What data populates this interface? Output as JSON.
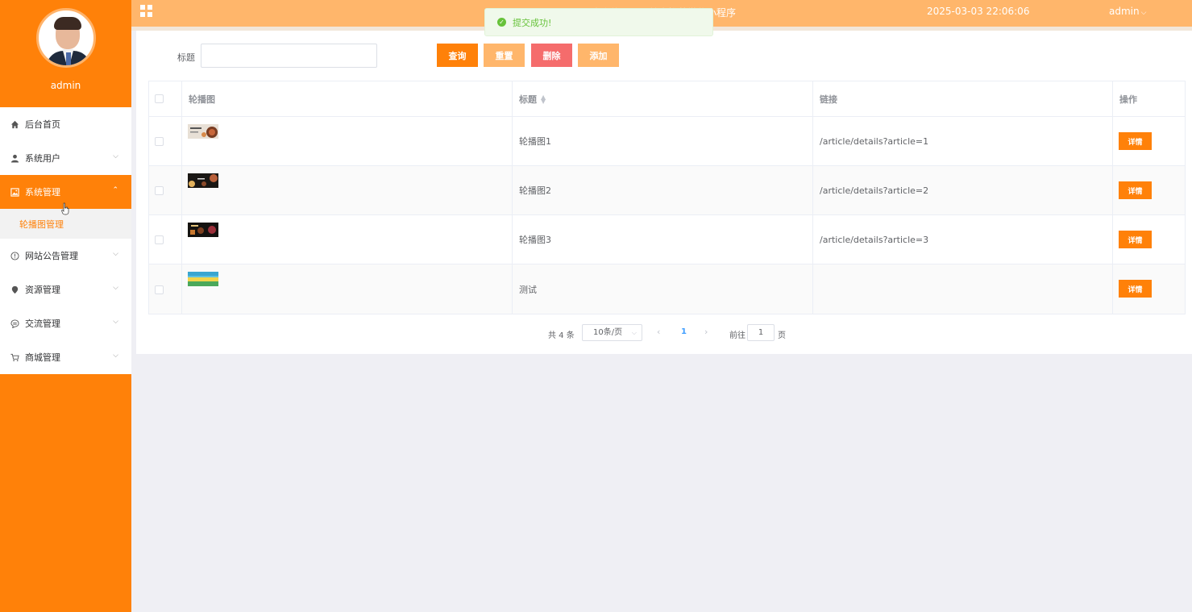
{
  "sidebar": {
    "username": "admin",
    "menu": [
      {
        "label": "后台首页",
        "icon": "home-icon",
        "has_children": false
      },
      {
        "label": "系统用户",
        "icon": "user-icon",
        "has_children": true
      },
      {
        "label": "系统管理",
        "icon": "picture-icon",
        "has_children": true,
        "active": true,
        "expanded": true
      },
      {
        "label": "网站公告管理",
        "icon": "info-circle-icon",
        "has_children": true
      },
      {
        "label": "资源管理",
        "icon": "location-pin-icon",
        "has_children": true
      },
      {
        "label": "交流管理",
        "icon": "chat-bubble-icon",
        "has_children": true
      },
      {
        "label": "商城管理",
        "icon": "shopping-cart-icon",
        "has_children": true
      }
    ],
    "submenu_active": "轮播图管理"
  },
  "header": {
    "title": "欢迎使用源面美食推荐微信小程序",
    "datetime": "2025-03-03 22:06:06",
    "user": "admin"
  },
  "toast": {
    "message": "提交成功!",
    "type": "success"
  },
  "search": {
    "label": "标题",
    "value": "",
    "buttons": {
      "query": "查询",
      "reset": "重置",
      "delete": "删除",
      "add": "添加"
    }
  },
  "table": {
    "columns": [
      "轮播图",
      "标题",
      "链接",
      "操作"
    ],
    "rows": [
      {
        "title": "轮播图1",
        "link": "/article/details?article=1",
        "action": "详情"
      },
      {
        "title": "轮播图2",
        "link": "/article/details?article=2",
        "action": "详情"
      },
      {
        "title": "轮播图3",
        "link": "/article/details?article=3",
        "action": "详情"
      },
      {
        "title": "测试",
        "link": "",
        "action": "详情"
      }
    ]
  },
  "pagination": {
    "total_text": "共 4 条",
    "page_size": "10条/页",
    "current_page": "1",
    "goto_label": "前往",
    "goto_value": "1",
    "goto_unit": "页"
  },
  "colors": {
    "primary": "#ff8109",
    "header": "#ffb66b",
    "danger": "#f56c6c",
    "success": "#67c23a"
  }
}
